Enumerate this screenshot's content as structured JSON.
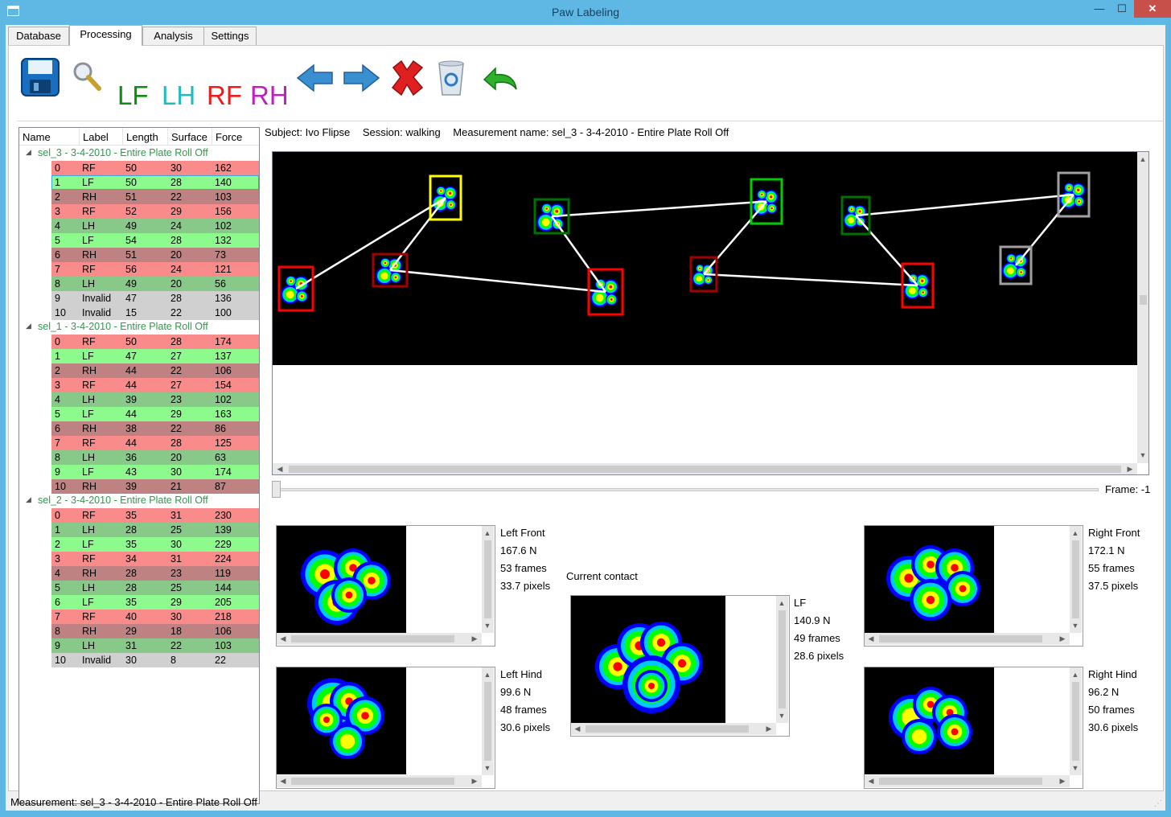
{
  "window": {
    "title": "Paw Labeling",
    "minimize": "—",
    "maximize": "☐",
    "close": "✕"
  },
  "tabs": [
    {
      "label": "Database",
      "active": false
    },
    {
      "label": "Processing",
      "active": true
    },
    {
      "label": "Analysis",
      "active": false
    },
    {
      "label": "Settings",
      "active": false
    }
  ],
  "toolbar": {
    "icons": [
      "save-icon",
      "search-icon",
      "arrow-left-icon",
      "arrow-right-icon",
      "delete-icon",
      "recycle-bin-icon",
      "undo-icon"
    ],
    "paw_labels": [
      {
        "text": "LF",
        "color": "#138a13"
      },
      {
        "text": "LH",
        "color": "#1fbcc0"
      },
      {
        "text": "RF",
        "color": "#ec1c1c"
      },
      {
        "text": "RH",
        "color": "#c020c0"
      }
    ]
  },
  "tree": {
    "headers": [
      "Name",
      "Label",
      "Length",
      "Surface",
      "Force"
    ],
    "colors": {
      "RF": "#f98b8b",
      "LF": "#8dfa8d",
      "RH": "#bf8282",
      "LH": "#88c888",
      "Invalid": "#d0d0d0"
    },
    "groups": [
      {
        "name": "sel_3 - 3-4-2010 - Entire Plate Roll Off",
        "rows": [
          [
            "0",
            "RF",
            "50",
            "30",
            "162"
          ],
          [
            "1",
            "LF",
            "50",
            "28",
            "140"
          ],
          [
            "2",
            "RH",
            "51",
            "22",
            "103"
          ],
          [
            "3",
            "RF",
            "52",
            "29",
            "156"
          ],
          [
            "4",
            "LH",
            "49",
            "24",
            "102"
          ],
          [
            "5",
            "LF",
            "54",
            "28",
            "132"
          ],
          [
            "6",
            "RH",
            "51",
            "20",
            "73"
          ],
          [
            "7",
            "RF",
            "56",
            "24",
            "121"
          ],
          [
            "8",
            "LH",
            "49",
            "20",
            "56"
          ],
          [
            "9",
            "Invalid",
            "47",
            "28",
            "136"
          ],
          [
            "10",
            "Invalid",
            "15",
            "22",
            "100"
          ]
        ]
      },
      {
        "name": "sel_1 - 3-4-2010 - Entire Plate Roll Off",
        "rows": [
          [
            "0",
            "RF",
            "50",
            "28",
            "174"
          ],
          [
            "1",
            "LF",
            "47",
            "27",
            "137"
          ],
          [
            "2",
            "RH",
            "44",
            "22",
            "106"
          ],
          [
            "3",
            "RF",
            "44",
            "27",
            "154"
          ],
          [
            "4",
            "LH",
            "39",
            "23",
            "102"
          ],
          [
            "5",
            "LF",
            "44",
            "29",
            "163"
          ],
          [
            "6",
            "RH",
            "38",
            "22",
            "86"
          ],
          [
            "7",
            "RF",
            "44",
            "28",
            "125"
          ],
          [
            "8",
            "LH",
            "36",
            "20",
            "63"
          ],
          [
            "9",
            "LF",
            "43",
            "30",
            "174"
          ],
          [
            "10",
            "RH",
            "39",
            "21",
            "87"
          ]
        ]
      },
      {
        "name": "sel_2 - 3-4-2010 - Entire Plate Roll Off",
        "rows": [
          [
            "0",
            "RF",
            "35",
            "31",
            "230"
          ],
          [
            "1",
            "LH",
            "28",
            "25",
            "139"
          ],
          [
            "2",
            "LF",
            "35",
            "30",
            "229"
          ],
          [
            "3",
            "RF",
            "34",
            "31",
            "224"
          ],
          [
            "4",
            "RH",
            "28",
            "23",
            "119"
          ],
          [
            "5",
            "LH",
            "28",
            "25",
            "144"
          ],
          [
            "6",
            "LF",
            "35",
            "29",
            "205"
          ],
          [
            "7",
            "RF",
            "40",
            "30",
            "218"
          ],
          [
            "8",
            "RH",
            "29",
            "18",
            "106"
          ],
          [
            "9",
            "LH",
            "31",
            "22",
            "103"
          ],
          [
            "10",
            "Invalid",
            "30",
            "8",
            "22"
          ]
        ]
      }
    ]
  },
  "info": {
    "subject": "Subject: Ivo Flipse",
    "session": "Session: walking",
    "measurement": "Measurement name: sel_3 - 3-4-2010 - Entire Plate Roll Off"
  },
  "plate": {
    "box_colors": {
      "RF": "#ff0000",
      "LF": "#00cc00",
      "RH": "#a00000",
      "LH": "#007000",
      "Invalid": "#a0a0a0",
      "Current": "#ffff00"
    }
  },
  "slider": {
    "frame_text": "Frame: -1",
    "value": -1
  },
  "paws": {
    "left_front": {
      "name": "Left Front",
      "force": "167.6 N",
      "frames": "53 frames",
      "pixels": "33.7 pixels"
    },
    "left_hind": {
      "name": "Left Hind",
      "force": "99.6 N",
      "frames": "48 frames",
      "pixels": "30.6 pixels"
    },
    "current": {
      "title": "Current contact",
      "name": "LF",
      "force": "140.9 N",
      "frames": "49 frames",
      "pixels": "28.6 pixels"
    },
    "right_front": {
      "name": "Right Front",
      "force": "172.1 N",
      "frames": "55 frames",
      "pixels": "37.5 pixels"
    },
    "right_hind": {
      "name": "Right Hind",
      "force": "96.2 N",
      "frames": "50 frames",
      "pixels": "30.6 pixels"
    }
  },
  "status": "Measurement: sel_3 - 3-4-2010 - Entire Plate Roll Off"
}
